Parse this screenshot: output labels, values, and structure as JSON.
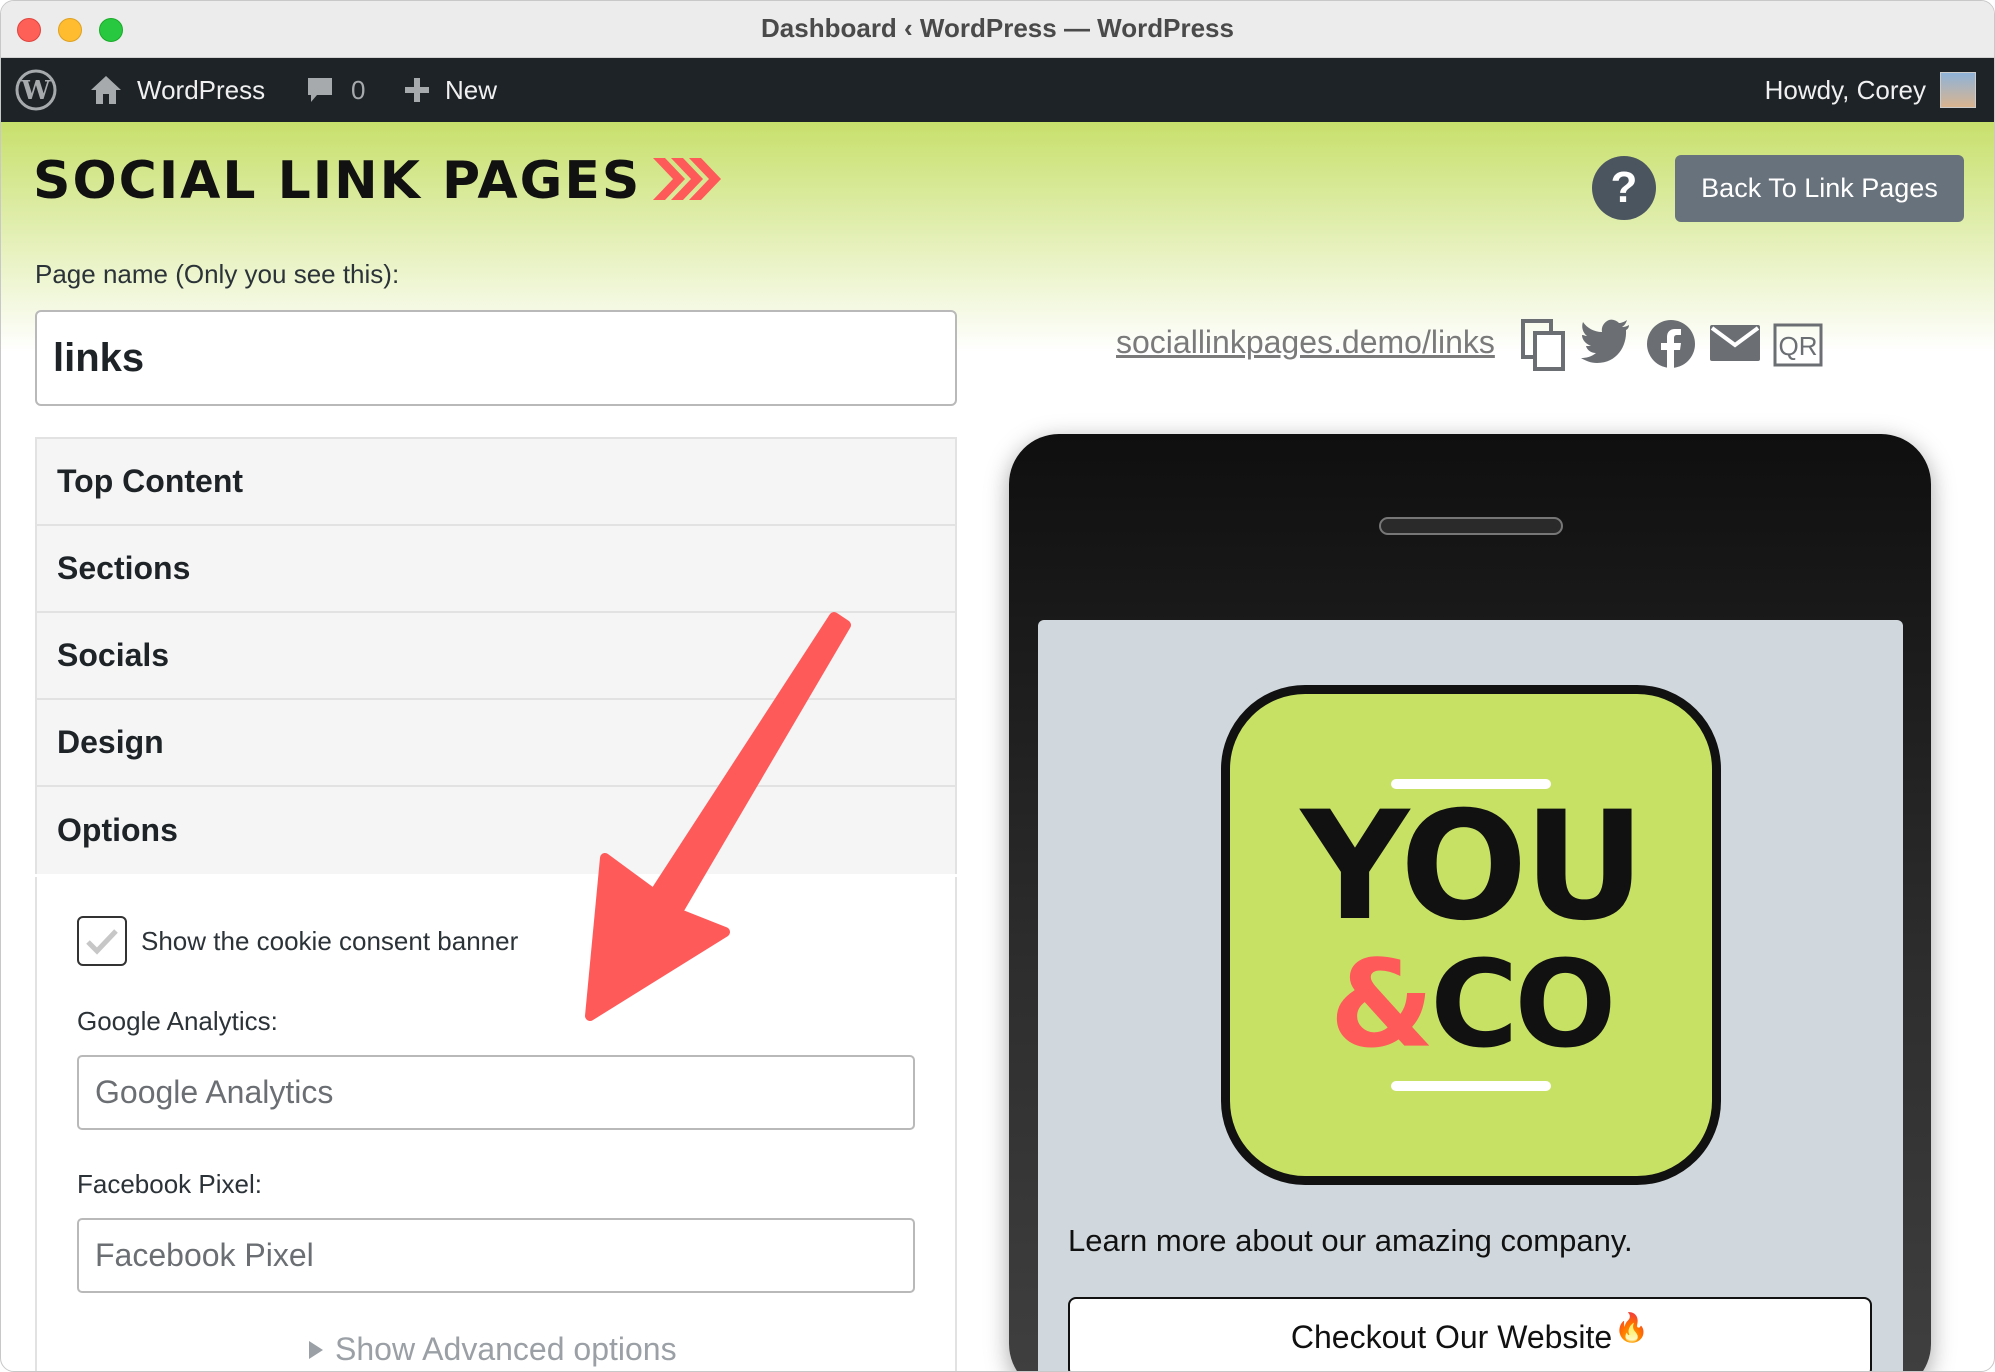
{
  "window": {
    "title": "Dashboard ‹ WordPress — WordPress"
  },
  "admin_bar": {
    "site_name": "WordPress",
    "comments_count": "0",
    "new_label": "New",
    "greeting": "Howdy, Corey"
  },
  "header": {
    "brand": "SOCIAL LINK PAGES",
    "help_label": "?",
    "back_button": "Back To Link Pages"
  },
  "editor": {
    "page_name_label": "Page name (Only you see this):",
    "page_name_value": "links",
    "sections": [
      "Top Content",
      "Sections",
      "Socials",
      "Design",
      "Options"
    ],
    "options": {
      "cookie_label": "Show the cookie consent banner",
      "cookie_checked": true,
      "ga_label": "Google Analytics:",
      "ga_placeholder": "Google Analytics",
      "fb_label": "Facebook Pixel:",
      "fb_placeholder": "Facebook Pixel",
      "advanced_label": "Show Advanced options"
    }
  },
  "share": {
    "url": "sociallinkpages.demo/links",
    "icons": [
      "copy-icon",
      "twitter-icon",
      "facebook-icon",
      "email-icon",
      "qr-icon"
    ],
    "qr_text": "QR"
  },
  "preview": {
    "logo_top": "YOU",
    "logo_amp": "&",
    "logo_bottom": "CO",
    "description": "Learn more about our amazing company.",
    "button_label": "Checkout Our Website",
    "button_emoji": "🔥"
  },
  "colors": {
    "brand_green": "#c6e164",
    "accent_red": "#ff5a5a",
    "admin_bar": "#1d2327",
    "back_button": "#68727c"
  }
}
